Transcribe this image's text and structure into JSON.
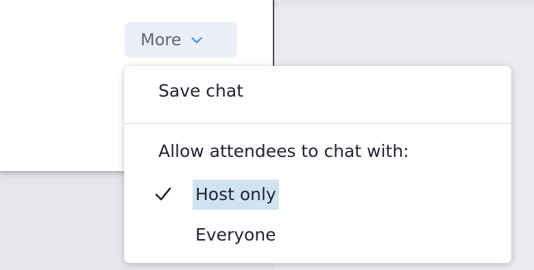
{
  "more_button": {
    "label": "More",
    "icon": "chevron-down-icon"
  },
  "menu": {
    "save_chat_label": "Save chat",
    "permission_header": "Allow attendees to chat with:",
    "options": [
      {
        "label": "Host only",
        "checked": true,
        "icon": "checkmark-icon"
      },
      {
        "label": "Everyone",
        "checked": false
      }
    ]
  },
  "colors": {
    "accent": "#2d8cff",
    "selection_highlight": "#cfe3f1",
    "button_background": "#eceef8"
  }
}
